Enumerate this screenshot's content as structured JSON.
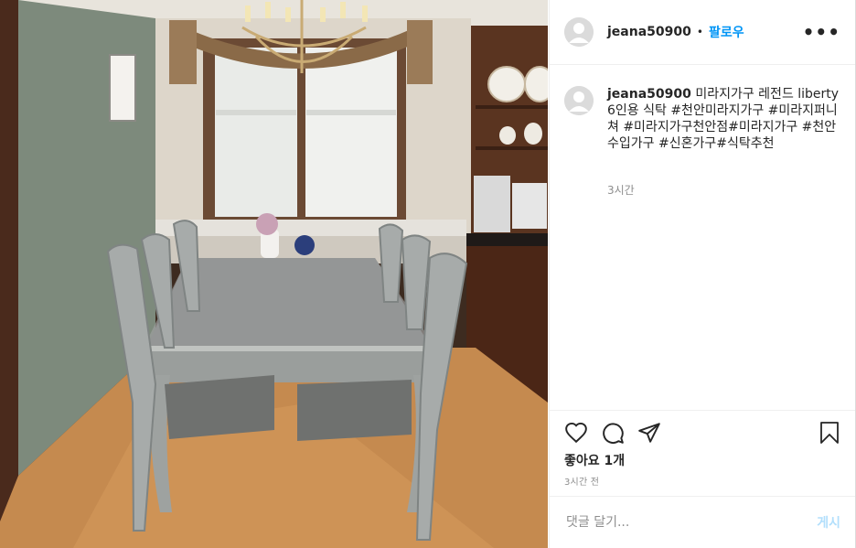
{
  "post": {
    "username": "jeana50900",
    "follow_label": "팔로우",
    "separator": "•",
    "more_label": "•••",
    "caption": "미라지가구 레전드 liberty 6인용 식탁 #천안미라지가구 #미라지퍼니쳐 #미라지가구천안점#미라지가구 #천안수입가구 #신혼가구#식탁추천",
    "comment_time": "3시간",
    "likes": "좋아요 1개",
    "posted_ago": "3시간 전"
  },
  "comment_box": {
    "placeholder": "댓글 달기...",
    "post_label": "게시"
  },
  "icons": {
    "like": "heart-icon",
    "comment": "comment-bubble-icon",
    "share": "paper-plane-icon",
    "save": "bookmark-icon",
    "avatar": "default-avatar-icon"
  },
  "colors": {
    "follow": "#0095f6",
    "post_disabled": "#b2dffc",
    "secondary_text": "#8e8e8e"
  }
}
